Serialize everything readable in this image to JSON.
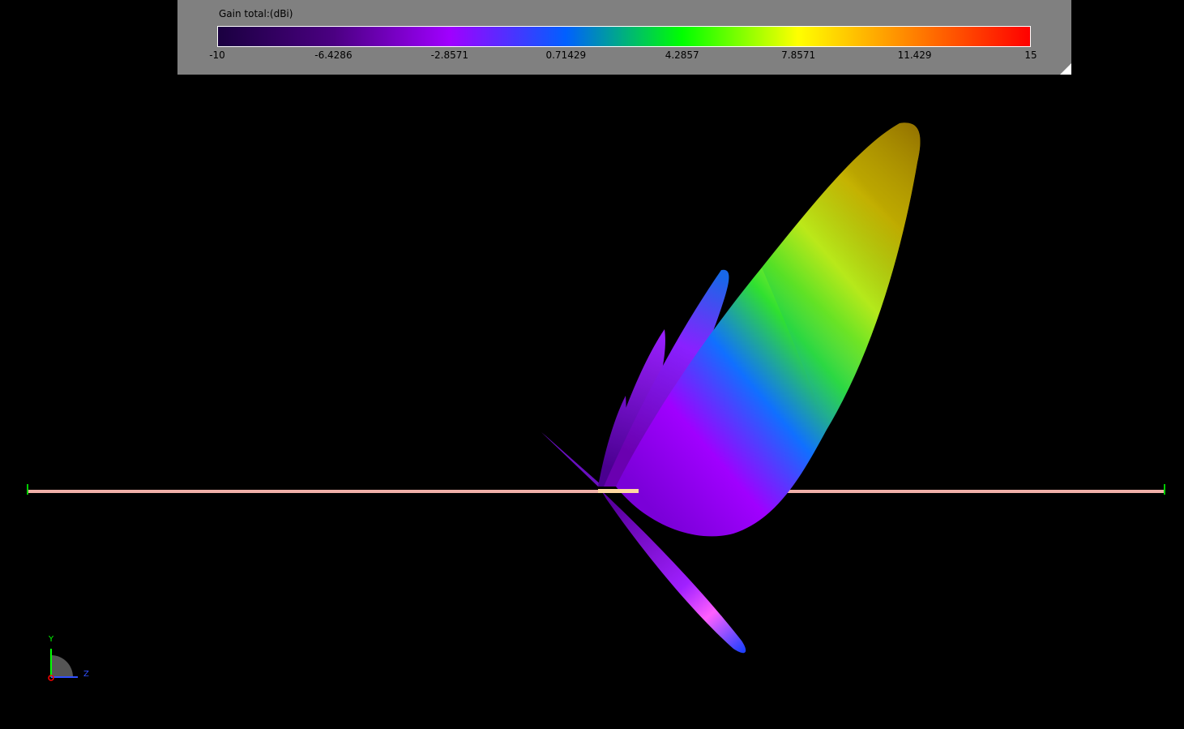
{
  "legend": {
    "title": "Gain total:(dBi)",
    "ticks": [
      "-10",
      "-6.4286",
      "-2.8571",
      "0.71429",
      "4.2857",
      "7.8571",
      "11.429",
      "15"
    ],
    "colors": [
      "#1a0040",
      "#4b0082",
      "#a000ff",
      "#0060ff",
      "#00ff00",
      "#ffff00",
      "#ff8000",
      "#ff0000"
    ]
  },
  "axes": {
    "y_label": "Y",
    "z_label": "Z",
    "y_color": "#00ff00",
    "z_color": "#3050ff",
    "x_color": "#ff0000"
  },
  "scene": {
    "ground_color": "#f0b0a8",
    "ground_edge_color": "#00cc00"
  }
}
